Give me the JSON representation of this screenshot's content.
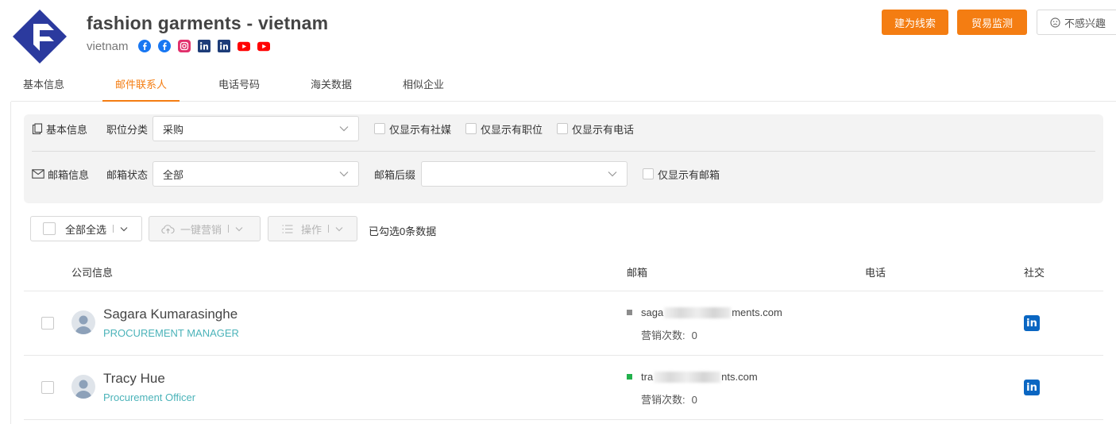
{
  "company": {
    "name": "fashion garments - vietnam",
    "country": "vietnam",
    "social_icons": [
      "facebook-icon",
      "facebook-icon",
      "instagram-icon",
      "linkedin-icon",
      "linkedin-icon",
      "youtube-icon",
      "youtube-icon"
    ]
  },
  "header_buttons": {
    "lead": "建为线索",
    "trade": "贸易监测",
    "not_interested": "不感兴趣"
  },
  "tabs": [
    {
      "label": "基本信息"
    },
    {
      "label": "邮件联系人"
    },
    {
      "label": "电话号码"
    },
    {
      "label": "海关数据"
    },
    {
      "label": "相似企业"
    }
  ],
  "filters": {
    "basic_section": "基本信息",
    "position_label": "职位分类",
    "position_value": "采购",
    "only_social": "仅显示有社媒",
    "only_position": "仅显示有职位",
    "only_phone": "仅显示有电话",
    "email_section": "邮箱信息",
    "email_status_label": "邮箱状态",
    "email_status_value": "全部",
    "email_suffix_label": "邮箱后缀",
    "email_suffix_value": "",
    "only_email": "仅显示有邮箱"
  },
  "toolbar": {
    "select_all": "全部全选",
    "one_click_marketing": "一键营销",
    "actions": "操作",
    "selected_info": "已勾选0条数据"
  },
  "table": {
    "headers": {
      "company": "公司信息",
      "email": "邮箱",
      "phone": "电话",
      "social": "社交"
    },
    "rows": [
      {
        "name": "Sagara Kumarasinghe",
        "title": "PROCUREMENT MANAGER",
        "email_prefix": "saga",
        "email_suffix": "ments.com",
        "status_color": "#8c8c8c",
        "marketing_label": "营销次数:",
        "marketing_count": "0"
      },
      {
        "name": "Tracy Hue",
        "title": "Procurement Officer",
        "email_prefix": "tra",
        "email_suffix": "nts.com",
        "status_color": "#22b14c",
        "marketing_label": "营销次数:",
        "marketing_count": "0"
      }
    ]
  },
  "colors": {
    "accent": "#f47d12",
    "title_teal": "#4bb3b9",
    "logo_blue": "#2b3a9e",
    "linkedin": "#0a66c2"
  }
}
